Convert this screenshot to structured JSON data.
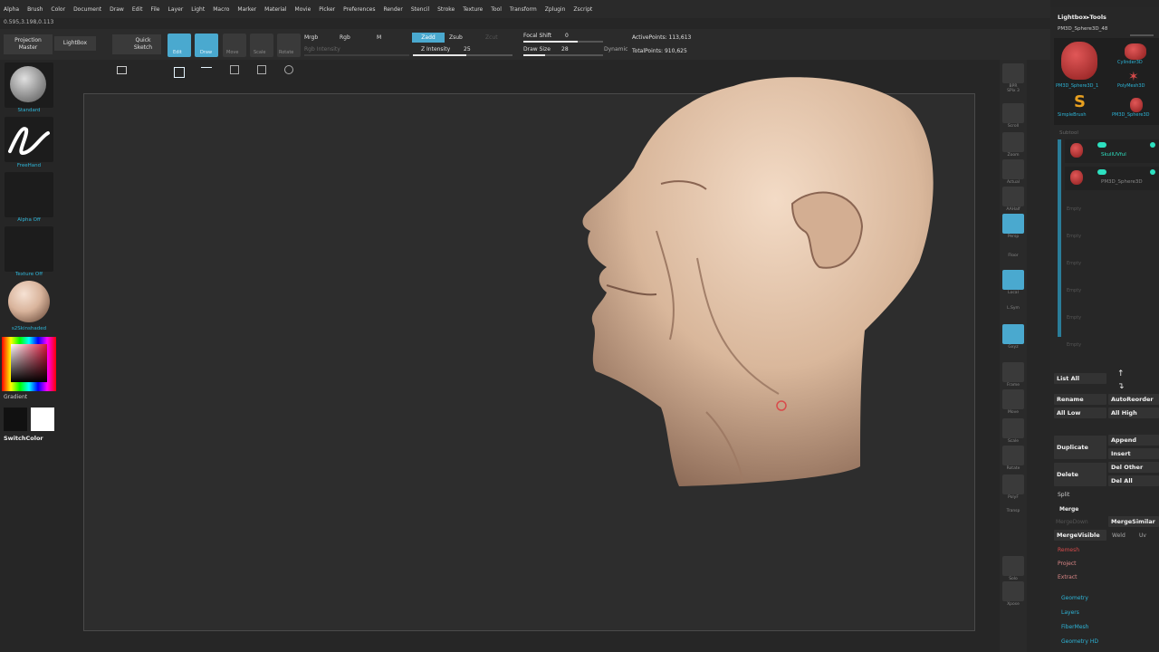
{
  "menu": [
    "Alpha",
    "Brush",
    "Color",
    "Document",
    "Draw",
    "Edit",
    "File",
    "Layer",
    "Light",
    "Macro",
    "Marker",
    "Material",
    "Movie",
    "Picker",
    "Preferences",
    "Render",
    "Stencil",
    "Stroke",
    "Texture",
    "Tool",
    "Transform",
    "Zplugin",
    "Zscript"
  ],
  "coords": "0.595,3.198,0.113",
  "topbar": {
    "projection_master": "Projection\nMaster",
    "lightbox": "LightBox",
    "quick_sketch": "Quick\nSketch",
    "edit": "Edit",
    "draw": "Draw",
    "move": "Move",
    "scale": "Scale",
    "rotate": "Rotate",
    "mrgb": "Mrgb",
    "rgb": "Rgb",
    "m": "M",
    "rgb_intensity": "Rgb Intensity",
    "zadd": "Zadd",
    "zsub": "Zsub",
    "zcut": "Zcut",
    "z_intensity_label": "Z Intensity",
    "z_intensity_value": "25",
    "focal_shift_label": "Focal Shift",
    "focal_shift_value": "0",
    "draw_size_label": "Draw Size",
    "draw_size_value": "28",
    "dynamic": "Dynamic",
    "active_points": "ActivePoints: 113,613",
    "total_points": "TotalPoints: 910,625"
  },
  "left": {
    "brush": "Standard",
    "stroke": "FreeHand",
    "alpha": "Alpha Off",
    "texture": "Texture Off",
    "material": "s2Skinshaded",
    "gradient": "Gradient",
    "switch_color": "SwitchColor"
  },
  "right_tools": {
    "bpr": "BPR",
    "spix": "SPix 3",
    "scroll": "Scroll",
    "zoom": "Zoom",
    "actual": "Actual",
    "aahalf": "AAHalf",
    "persp": "Persp",
    "floor": "Floor",
    "local": "Local",
    "lsym": "L.Sym",
    "gxyz": "Gxyz",
    "frame": "Frame",
    "move": "Move",
    "scale": "Scale",
    "rotate": "Rotate",
    "polyf": "PolyF",
    "transp": "Transp",
    "solo": "Solo",
    "xpose": "Xpose"
  },
  "panel": {
    "title": "Lightbox▸Tools",
    "current_tool": "PM3D_Sphere3D_48",
    "thumbs": [
      "PM3D_Sphere3D_1",
      "Cylinder3D",
      "SimpleBrush",
      "PolyMesh3D",
      "PM3D_Sphere3D"
    ],
    "subtool_header": "Subtool",
    "subtools": [
      "SkullUVful",
      "PM3D_Sphere3D"
    ],
    "empty_slots": [
      "Empty",
      "Empty",
      "Empty",
      "Empty",
      "Empty",
      "Empty"
    ],
    "list_all": "List All",
    "rename": "Rename",
    "auto_reorder": "AutoReorder",
    "all_low": "All Low",
    "all_high": "All High",
    "duplicate": "Duplicate",
    "append": "Append",
    "insert": "Insert",
    "delete": "Delete",
    "del_other": "Del Other",
    "del_all": "Del All",
    "split": "Split",
    "merge": "Merge",
    "merge_down": "MergeDown",
    "merge_similar": "MergeSimilar",
    "merge_visible": "MergeVisible",
    "weld": "Weld",
    "uv": "Uv",
    "remesh": "Remesh",
    "project": "Project",
    "extract": "Extract",
    "geometry": "Geometry",
    "layers": "Layers",
    "fibermesh": "FiberMesh",
    "geometry_hd": "Geometry HD"
  }
}
